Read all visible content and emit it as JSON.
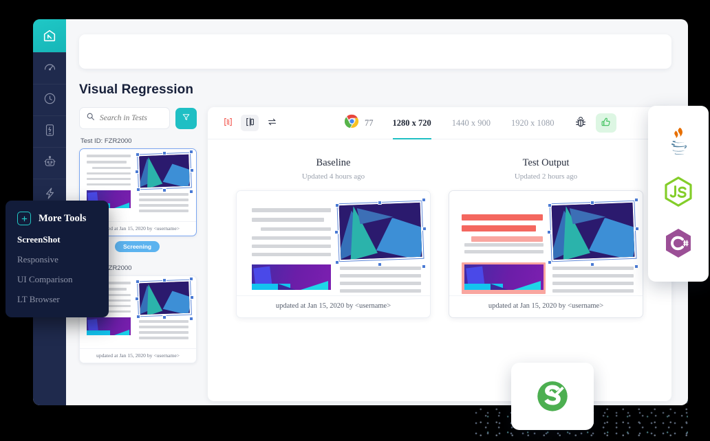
{
  "app": {
    "page_title": "Visual Regression"
  },
  "rail": {
    "logo_icon": "lambdatest-logo-icon",
    "items": [
      {
        "icon": "speedometer-icon",
        "name": "performance"
      },
      {
        "icon": "clock-icon",
        "name": "history"
      },
      {
        "icon": "mobile-device-icon",
        "name": "devices"
      },
      {
        "icon": "robot-icon",
        "name": "automation"
      },
      {
        "icon": "lightning-bolt-icon",
        "name": "smart-tests"
      }
    ]
  },
  "tests_pane": {
    "search": {
      "placeholder": "Search in Tests",
      "value": "",
      "icon": "search-icon"
    },
    "filter_button": {
      "icon": "filter-funnel-icon",
      "color": "#1fbfc4"
    },
    "items": [
      {
        "test_id_label": "Test ID: FZR2000",
        "footer": "updated at Jan 15, 2020 by <username>",
        "badge": "Screening",
        "selected": true
      },
      {
        "test_id_label": "Test ID: FZR2000",
        "footer": "updated at Jan 15, 2020 by <username>",
        "badge": "",
        "selected": false
      }
    ]
  },
  "toolbar": {
    "view_modes": [
      {
        "icon": "diff-overlay-icon",
        "active": false
      },
      {
        "icon": "side-by-side-split-icon",
        "active": true
      },
      {
        "icon": "swap-arrows-icon",
        "active": false
      }
    ],
    "browser": {
      "icon": "chrome-icon",
      "version": "77"
    },
    "resolutions": [
      {
        "label": "1280 x 720",
        "active": true
      },
      {
        "label": "1440 x 900",
        "active": false
      },
      {
        "label": "1920 x 1080",
        "active": false
      }
    ],
    "bug_button": {
      "icon": "bug-icon"
    },
    "approve_button": {
      "icon": "thumbs-up-icon",
      "bg": "#ddf6e3",
      "color": "#3cc05b"
    }
  },
  "compare": {
    "columns": [
      {
        "title": "Baseline",
        "subtitle": "Updated 4 hours ago",
        "footer": "updated at Jan 15, 2020 by <username>",
        "has_diff": false
      },
      {
        "title": "Test Output",
        "subtitle": "Updated 2 hours ago",
        "footer": "updated at Jan 15, 2020 by <username>",
        "has_diff": true
      }
    ]
  },
  "more_tools": {
    "plus_icon": "plus-square-icon",
    "title": "More Tools",
    "items": [
      {
        "label": "ScreenShot",
        "active": true
      },
      {
        "label": "Responsive",
        "active": false
      },
      {
        "label": "UI Comparison",
        "active": false
      },
      {
        "label": "LT Browser",
        "active": false
      }
    ]
  },
  "languages": [
    {
      "icon": "java-icon",
      "name": "Java"
    },
    {
      "icon": "nodejs-icon",
      "name": "JS"
    },
    {
      "icon": "csharp-icon",
      "name": "C#"
    }
  ],
  "selenium_badge": {
    "icon": "selenium-icon",
    "label": "Se"
  }
}
